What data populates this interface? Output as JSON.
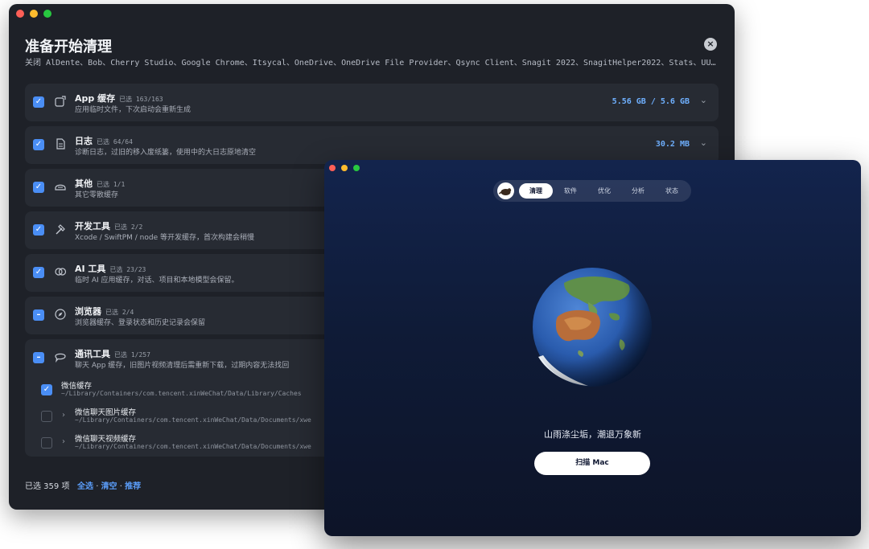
{
  "back_window": {
    "title": "准备开始清理",
    "close_icon": "close-circle-icon",
    "subtitle": "关闭 AlDente、Bob、Cherry Studio、Google Chrome、Itsycal、OneDrive、OneDrive File Provider、Qsync Client、Snagit 2022、SnagitHelper2022、Stats、UU…",
    "categories": [
      {
        "name": "App 缓存",
        "count": "已选 163/163",
        "desc": "应用临时文件，下次启动会重新生成",
        "size": "5.56 GB / 5.6 GB",
        "state": "checked",
        "icon": "app-window-icon"
      },
      {
        "name": "日志",
        "count": "已选 64/64",
        "desc": "诊断日志，过旧的移入废纸篓，使用中的大日志原地清空",
        "size": "30.2 MB",
        "state": "checked",
        "icon": "document-icon"
      },
      {
        "name": "其他",
        "count": "已选 1/1",
        "desc": "其它零散缓存",
        "size": "",
        "state": "checked",
        "icon": "storage-icon"
      },
      {
        "name": "开发工具",
        "count": "已选 2/2",
        "desc": "Xcode / SwiftPM / node 等开发缓存，首次构建会稍慢",
        "size": "",
        "state": "checked",
        "icon": "hammer-icon"
      },
      {
        "name": "AI 工具",
        "count": "已选 23/23",
        "desc": "临时 AI 应用缓存，对话、项目和本地模型会保留。",
        "size": "",
        "state": "checked",
        "icon": "ai-brain-icon"
      },
      {
        "name": "浏览器",
        "count": "已选 2/4",
        "desc": "浏览器缓存、登录状态和历史记录会保留",
        "size": "",
        "state": "partial",
        "icon": "compass-icon"
      },
      {
        "name": "通讯工具",
        "count": "已选 1/257",
        "desc": "聊天 App 缓存，旧图片视频清理后需重新下载，过期内容无法找回",
        "size": "",
        "state": "partial",
        "icon": "chat-bubble-icon"
      }
    ],
    "subitems": [
      {
        "name": "微信缓存",
        "path": "~/Library/Containers/com.tencent.xinWeChat/Data/Library/Caches",
        "state": "checked"
      },
      {
        "name": "微信聊天图片缓存",
        "path": "~/Library/Containers/com.tencent.xinWeChat/Data/Documents/xwe",
        "state": "unchecked"
      },
      {
        "name": "微信聊天视频缓存",
        "path": "~/Library/Containers/com.tencent.xinWeChat/Data/Documents/xwe",
        "state": "unchecked"
      }
    ],
    "footer": {
      "selected": "已选 359 项",
      "select_all": "全选",
      "sep1": "·",
      "clear": "清空",
      "sep2": "·",
      "recommend": "推荐"
    }
  },
  "front_window": {
    "tabs": [
      "清理",
      "软件",
      "优化",
      "分析",
      "状态"
    ],
    "active_tab": 0,
    "slogan": "山雨涤尘垢，潮退万象新",
    "scan_button": "扫描 Mac"
  },
  "colors": {
    "accent": "#4a8ef5",
    "size_text": "#6fb0ff",
    "back_bg": "#1e2128",
    "card_bg": "#272b33",
    "front_bg": "#13244d"
  }
}
